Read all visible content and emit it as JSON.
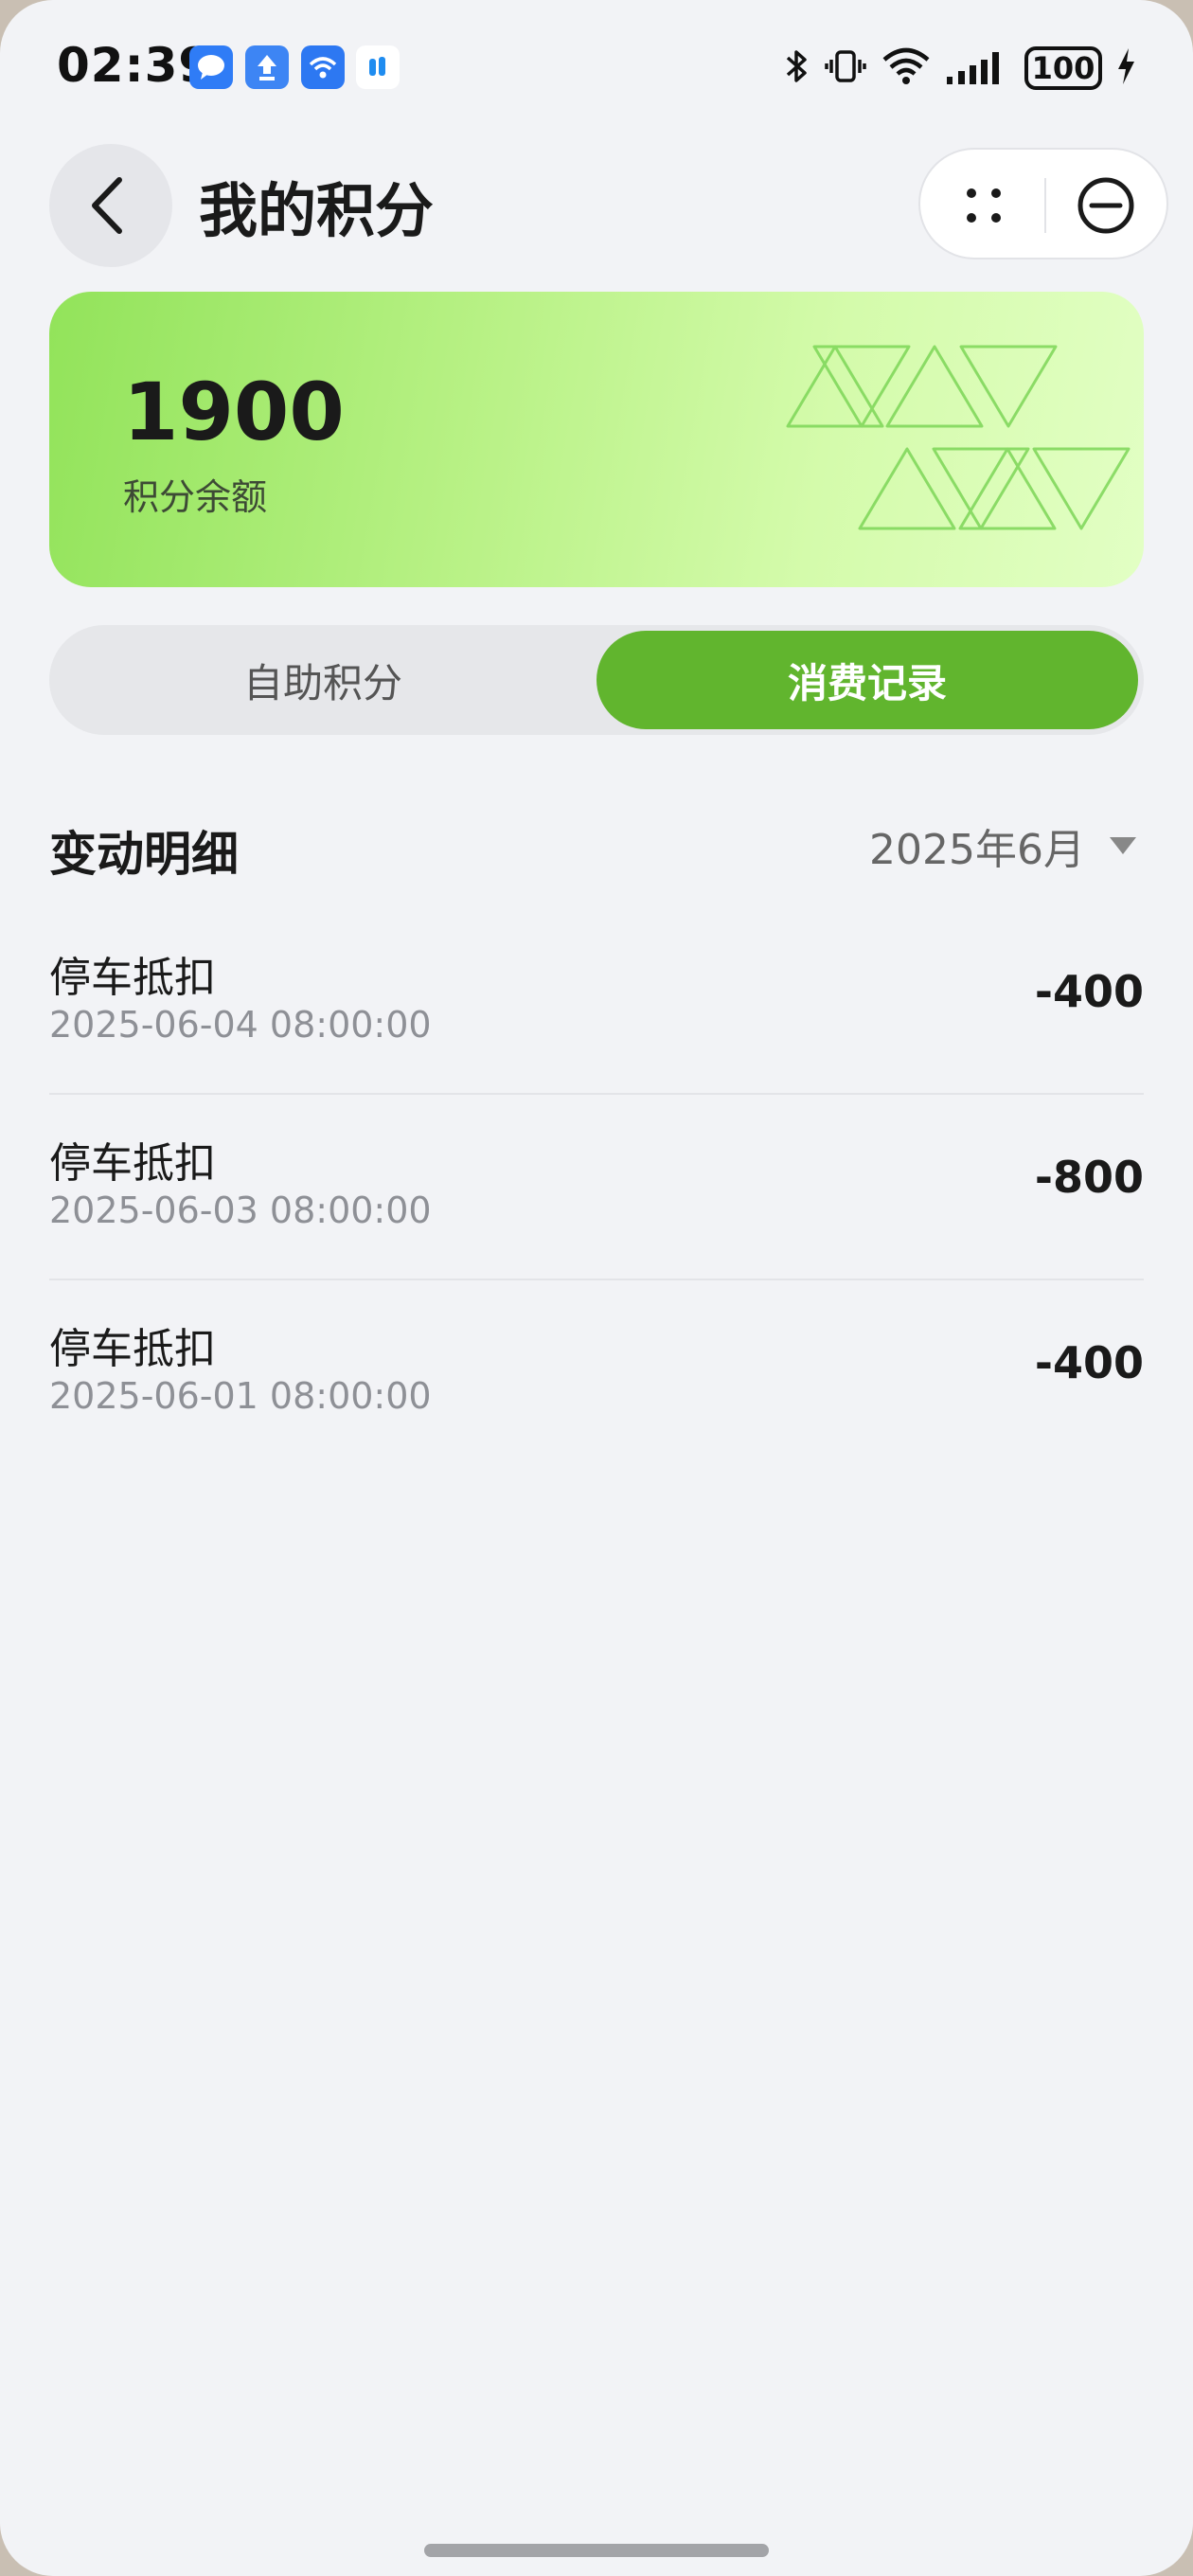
{
  "status_bar": {
    "time": "02:39",
    "notification_icons": [
      "message-icon",
      "upload-icon",
      "wifi-share-icon",
      "app-icon"
    ],
    "right_icons": [
      "bluetooth-icon",
      "vibrate-icon",
      "wifi-icon",
      "signal-icon",
      "charging-icon"
    ],
    "battery": "100"
  },
  "header": {
    "title": "我的积分",
    "back_icon": "chevron-left-icon",
    "capsule_icons": [
      "more-dots-icon",
      "close-circle-icon"
    ]
  },
  "points_card": {
    "value": "1900",
    "label": "积分余额",
    "colors": {
      "gradient_start": "#92e35a",
      "gradient_end": "#e2ffc4",
      "triangle_stroke": "#7dd658"
    }
  },
  "tabs": {
    "items": [
      {
        "label": "自助积分",
        "active": false
      },
      {
        "label": "消费记录",
        "active": true
      }
    ],
    "active_color": "#61b52e"
  },
  "section": {
    "title": "变动明细",
    "month": "2025年6月"
  },
  "records": [
    {
      "title": "停车抵扣",
      "time": "2025-06-04 08:00:00",
      "amount": "-400"
    },
    {
      "title": "停车抵扣",
      "time": "2025-06-03 08:00:00",
      "amount": "-800"
    },
    {
      "title": "停车抵扣",
      "time": "2025-06-01 08:00:00",
      "amount": "-400"
    }
  ]
}
